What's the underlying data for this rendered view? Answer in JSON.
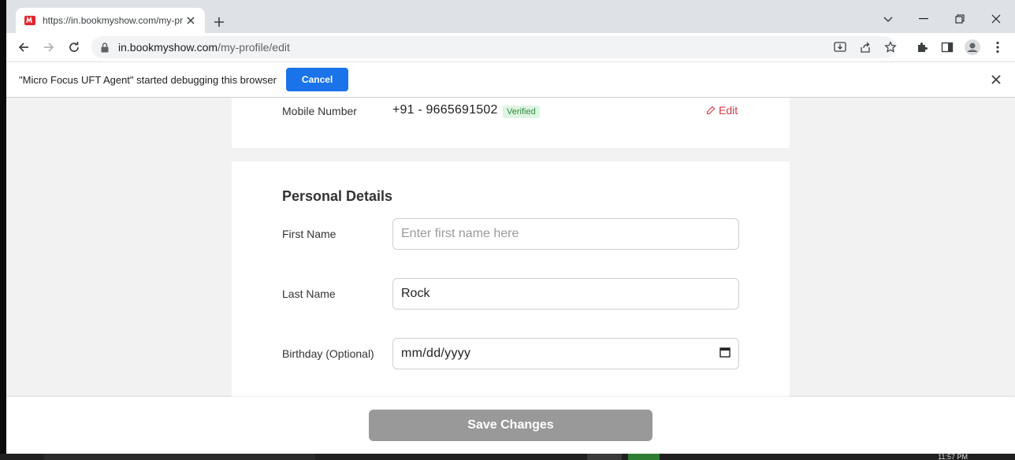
{
  "browser": {
    "tab": {
      "title": "https://in.bookmyshow.com/my-profile/edit",
      "favicon": "bookmyshow-logo-icon"
    },
    "url": {
      "host": "in.bookmyshow.com",
      "path": "/my-profile/edit"
    }
  },
  "infobar": {
    "message": "\"Micro Focus UFT Agent\" started debugging this browser",
    "cancel_label": "Cancel"
  },
  "contact": {
    "mobile_label": "Mobile Number",
    "mobile_value": "+91 - 9665691502",
    "verified_badge": "Verified",
    "edit_label": "Edit"
  },
  "personal": {
    "title": "Personal Details",
    "first_name": {
      "label": "First Name",
      "value": "",
      "placeholder": "Enter first name here"
    },
    "last_name": {
      "label": "Last Name",
      "value": "Rock",
      "placeholder": ""
    },
    "birthday": {
      "label": "Birthday (Optional)",
      "value": "mm/dd/yyyy"
    }
  },
  "footer": {
    "save_label": "Save Changes"
  },
  "taskbar": {
    "clock": "11:57 PM"
  },
  "colors": {
    "accent_red": "#dc3545",
    "info_button_blue": "#1a73e8",
    "verified_bg": "#dff5e3",
    "verified_text": "#2e8b3e",
    "save_disabled": "#999999"
  }
}
